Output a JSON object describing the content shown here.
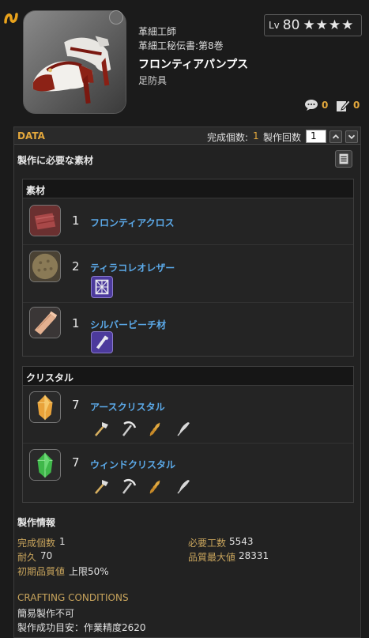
{
  "header": {
    "book_line1": "革細工師",
    "book_line2": "革細工秘伝書:第8巻",
    "item_name": "フロンティアパンプス",
    "item_category": "足防具",
    "level_label": "Lv",
    "level_value": "80",
    "stars": "★★★★",
    "comment_count": "0",
    "edit_count": "0"
  },
  "data_bar": {
    "label": "DATA",
    "yield_label": "完成個数:",
    "yield_value": "1",
    "craft_count_label": "製作回数",
    "craft_count_value": "1"
  },
  "materials_heading": "製作に必要な素材",
  "materials": {
    "heading": "素材",
    "items": [
      {
        "qty": "1",
        "name": "フロンティアクロス",
        "icon": "cloth-icon"
      },
      {
        "qty": "2",
        "name": "ティラコレオレザー",
        "icon": "leather-icon",
        "sub_icon": "weaver-icon"
      },
      {
        "qty": "1",
        "name": "シルバービーチ材",
        "icon": "lumber-icon",
        "sub_icon": "carpenter-icon"
      }
    ]
  },
  "crystals": {
    "heading": "クリスタル",
    "items": [
      {
        "qty": "7",
        "name": "アースクリスタル",
        "icon": "earth-crystal-icon",
        "color": "#e9a33a"
      },
      {
        "qty": "7",
        "name": "ウィンドクリスタル",
        "icon": "wind-crystal-icon",
        "color": "#3fb84a"
      }
    ],
    "gather_icons": [
      "hatchet-icon",
      "pickaxe-icon",
      "wheat-icon",
      "feather-icon"
    ]
  },
  "craft_info": {
    "heading": "製作情報",
    "yield_label": "完成個数",
    "yield_value": "1",
    "durability_label": "耐久",
    "durability_value": "70",
    "initial_quality_label": "初期品質値",
    "initial_quality_value": "上限50%",
    "required_progress_label": "必要工数",
    "required_progress_value": "5543",
    "max_quality_label": "品質最大値",
    "max_quality_value": "28331"
  },
  "conditions": {
    "heading": "CRAFTING CONDITIONS",
    "line1": "簡易製作不可",
    "line2": "製作成功目安：作業精度2620"
  },
  "colors": {
    "accent": "#e4a83c",
    "link": "#5ba9e8",
    "background": "#1b1b1b"
  }
}
